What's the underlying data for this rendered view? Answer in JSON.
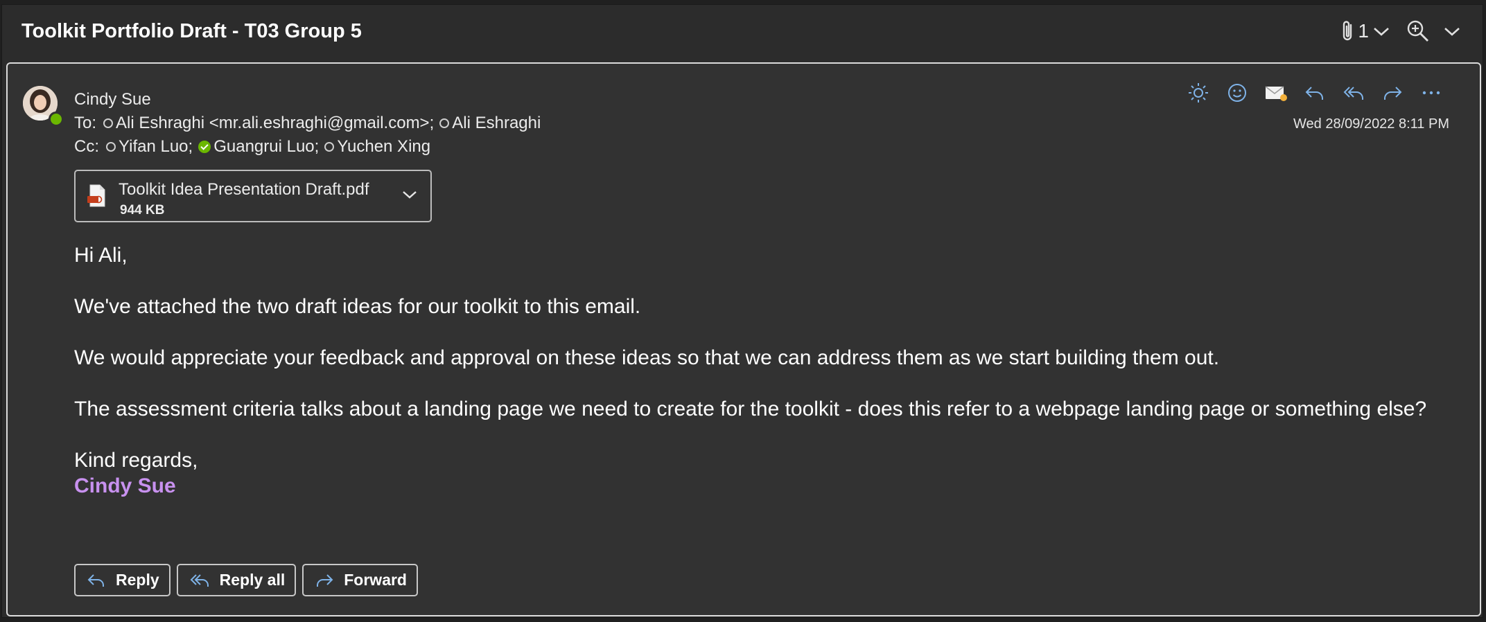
{
  "window": {
    "subject": "Toolkit Portfolio Draft - T03 Group 5",
    "attachment_count": "1"
  },
  "message": {
    "sender": "Cindy Sue",
    "to_label": "To:",
    "to": [
      {
        "name": "Ali Eshraghi <mr.ali.eshraghi@gmail.com>;",
        "status": "offline"
      },
      {
        "name": "Ali Eshraghi",
        "status": "offline"
      }
    ],
    "cc_label": "Cc:",
    "cc": [
      {
        "name": "Yifan Luo;",
        "status": "offline"
      },
      {
        "name": "Guangrui Luo;",
        "status": "available"
      },
      {
        "name": "Yuchen Xing",
        "status": "offline"
      }
    ],
    "datetime": "Wed 28/09/2022 8:11 PM",
    "actions": [
      "sun-icon",
      "emoji-icon",
      "envelope-icon",
      "reply-icon",
      "reply-all-icon",
      "forward-icon",
      "more-icon"
    ]
  },
  "attachment": {
    "name": "Toolkit Idea Presentation Draft.pdf",
    "size": "944 KB"
  },
  "body": {
    "greeting": "Hi Ali,",
    "p1": "We've attached the two draft ideas for our toolkit to this email.",
    "p2": "We would appreciate your feedback and approval on these ideas so that we can address them as we start building them out.",
    "p3": "The assessment criteria talks about a landing page we need to create for the toolkit - does this refer to a webpage landing page or something else?",
    "closing": "Kind regards,",
    "signature": "Cindy Sue"
  },
  "reply_bar": {
    "reply": "Reply",
    "reply_all": "Reply all",
    "forward": "Forward"
  },
  "colors": {
    "signature": "#c891ef",
    "accent_icon": "#7fb3e8",
    "presence_green": "#6bb700"
  }
}
